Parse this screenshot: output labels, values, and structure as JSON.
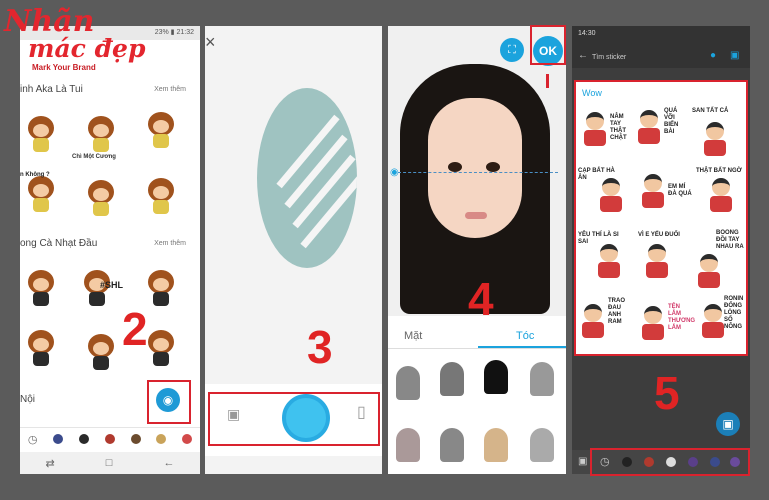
{
  "logo": {
    "line1": "Nhãn",
    "line2": "mác đẹp",
    "tagline": "Mark Your Brand"
  },
  "screen1": {
    "status_time": "23% ▮ 21:32",
    "section1_title": "inh Aka Là Tui",
    "section1_more": "Xem thêm",
    "section2_title": "ong Cà Nhạt Đầu",
    "section2_more": "Xem thêm",
    "section3_title": "Nội",
    "step_number": "2",
    "sticker_texts": [
      "Chì Một Cương",
      "n Không ?",
      "#SHL"
    ]
  },
  "screen2": {
    "step_number": "3",
    "close_symbol": "×"
  },
  "screen3": {
    "ok_label": "OK",
    "tab_face": "Mặt",
    "tab_hair": "Tóc",
    "step_number": "4",
    "accent_color": "#1ba3dd"
  },
  "screen4": {
    "status_time": "14:30",
    "search_placeholder": "Tìm sticker",
    "pack_title": "Wow",
    "step_number": "5",
    "sticker_texts": [
      "NÂM TAY THẬT CHẶT",
      "QUÁ VỠI BIỂN BÀI",
      "SAN TẤT CẢ",
      "CẠP BẤT HÀ ÂN",
      "EM MÍ ĐÀ QUÁ",
      "THẬT BẤT NGỜ",
      "YÊU THÍ LÀ SI SAI",
      "VÌ E YẾU ĐUỐI",
      "BOONG ĐỒI TAY NHAU RA",
      "TRAO ĐAU ANH RAM",
      "TỆN LẮM THƯƠNG LẮM",
      "RONIN ĐỐNG LÒNG SỐ NÔNG"
    ]
  },
  "colors": {
    "highlight": "#d9232e",
    "logo": "#e3262e",
    "fab": "#1e9ad6"
  }
}
